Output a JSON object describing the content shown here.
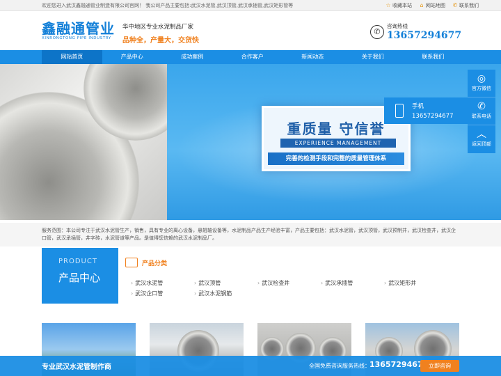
{
  "topbar": {
    "welcome": "欢迎您进入武汉鑫融通管业制造有限公司官网！ 我公司产品主要包括:武汉水泥管,武汉顶管,武汉承插管,武汉矩形管等",
    "links": [
      "收藏本站",
      "网站地图",
      "联系我们"
    ]
  },
  "header": {
    "logo_cn": "鑫融通管业",
    "logo_en": "XINRONGTONG PIPE INDUSTRY",
    "slogan_1": "华中地区专业水泥制品厂家",
    "slogan_2": "品种全，产量大，交货快",
    "hotline_label": "咨询热线",
    "hotline_number": "13657294677"
  },
  "nav": {
    "items": [
      "网站首页",
      "产品中心",
      "成功案例",
      "合作客户",
      "新闻动态",
      "关于我们",
      "联系我们"
    ],
    "active_index": 0
  },
  "banner": {
    "title": "重质量  守信誉",
    "subtitle": "EXPERIENCE MANAGEMENT",
    "strip": "完善的检测手段和完整的质量管理体系"
  },
  "float": {
    "phone_label": "手机",
    "phone_number": "13657294677",
    "items": [
      "官方微信",
      "联系电话",
      "返回顶部"
    ]
  },
  "scope": {
    "text": "服务范围：本公司专注于武汉水泥管生产，销售，具有专业的离心设备，悬辊轴设备等，水泥制品产品生产经验丰富，产品主要包括：武汉水泥管，武汉顶管，武汉预制井，武汉检查井，武汉企口管，武汉承插管，井字砖，水泥管道等产品。是值得您信赖的武汉水泥制品厂。"
  },
  "product_center": {
    "en": "PRODUCT",
    "cn": "产品中心",
    "category_label": "产品分类",
    "categories": [
      "武汉水泥管",
      "武汉顶管",
      "武汉检查井",
      "武汉承插管",
      "武汉矩形井",
      "武汉企口管",
      "武汉水泥钢筋"
    ]
  },
  "bottombar": {
    "left": "专业武汉水泥管制作商",
    "middle": "全国免费咨询服务热线：",
    "number": "13657294677",
    "button": "立即咨询"
  },
  "colors": {
    "primary": "#1b8ee4",
    "accent": "#f0811f",
    "nav_active": "#0d74c8"
  }
}
